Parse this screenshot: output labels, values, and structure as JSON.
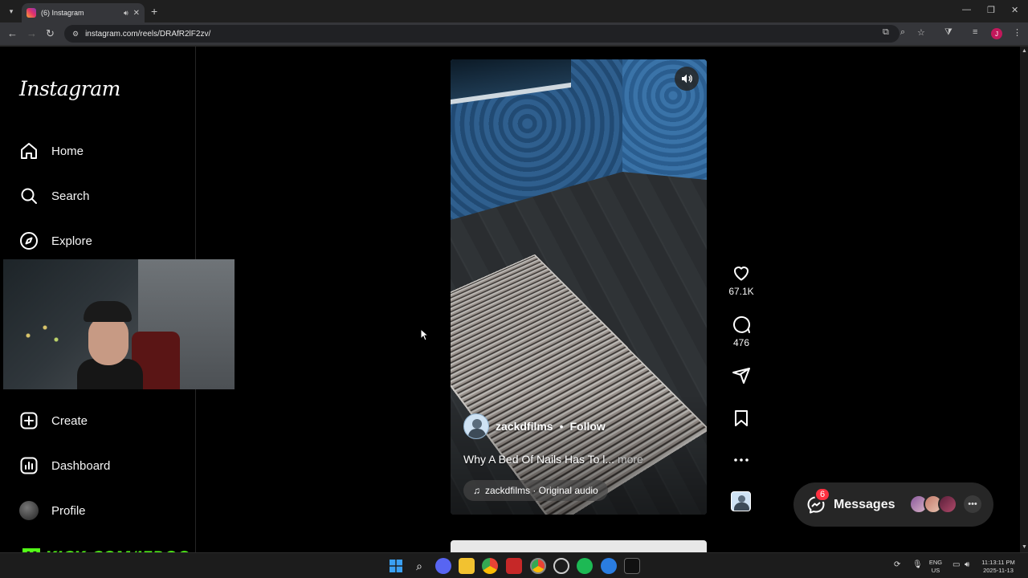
{
  "browser": {
    "tab_title": "(6) Instagram",
    "url": "instagram.com/reels/DRAfR2lF2zv/",
    "profile_initial": "J"
  },
  "sidebar": {
    "logo": "Instagram",
    "items": [
      {
        "label": "Home",
        "icon": "home-icon"
      },
      {
        "label": "Search",
        "icon": "search-icon"
      },
      {
        "label": "Explore",
        "icon": "compass-icon"
      },
      {
        "label": "Create",
        "icon": "plus-square-icon"
      },
      {
        "label": "Dashboard",
        "icon": "chart-icon"
      },
      {
        "label": "Profile",
        "icon": "avatar"
      }
    ]
  },
  "stream": {
    "kick_label": "KICK.COM/JERQO",
    "kick_color": "#53fc18"
  },
  "reel": {
    "username": "zackdfilms",
    "separator": "•",
    "follow_label": "Follow",
    "caption": "Why A Bed Of Nails Has To l...",
    "more_label": "more",
    "audio": "zackdfilms · Original audio",
    "likes": "67.1K",
    "comments": "476"
  },
  "messages": {
    "label": "Messages",
    "badge": "6"
  },
  "taskbar": {
    "lang_top": "ENG",
    "lang_bottom": "US",
    "time": "11:13:11 PM",
    "date": "2025-11-13"
  },
  "colors": {
    "accent_badge": "#ff3040",
    "background": "#000000",
    "sidebar_border": "#262626"
  }
}
